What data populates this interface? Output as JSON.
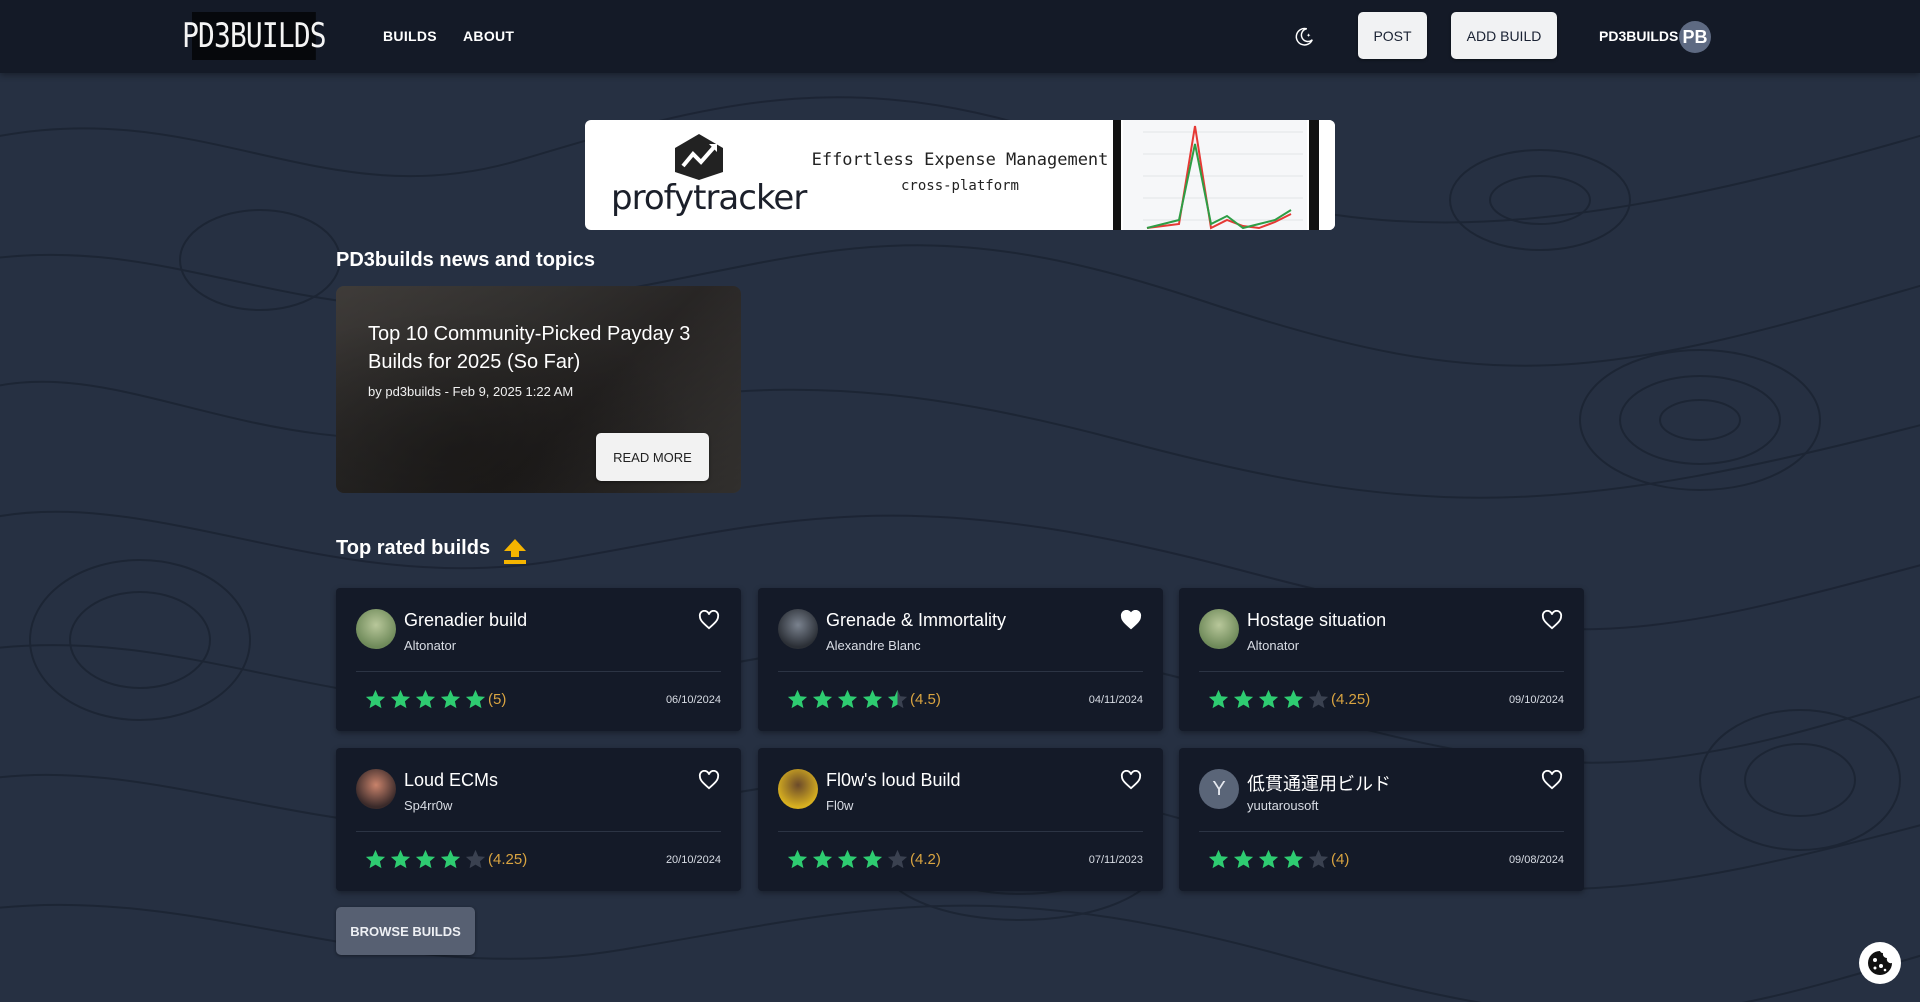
{
  "nav": {
    "logo_text": "PD3BUILDS",
    "links": [
      "BUILDS",
      "ABOUT"
    ],
    "theme_icon": "moon-icon",
    "post_label": "POST",
    "add_build_label": "ADD BUILD",
    "username": "PD3BUILDS",
    "avatar_initials": "PB"
  },
  "ad": {
    "brand": "profytracker",
    "tagline": "Effortless Expense Management",
    "subline": "cross-platform"
  },
  "news": {
    "heading": "PD3builds news and topics",
    "card": {
      "title": "Top 10 Community-Picked Payday 3 Builds for 2025 (So Far)",
      "meta": "by pd3builds - Feb 9, 2025 1:22 AM",
      "button": "READ MORE"
    }
  },
  "top_rated": {
    "heading": "Top rated builds",
    "icon": "trending-up-icon",
    "builds": [
      {
        "title": "Grenadier build",
        "author": "Altonator",
        "stars": 5,
        "rating": "(5)",
        "date": "06/10/2024",
        "favorited": false
      },
      {
        "title": "Grenade & Immortality",
        "author": "Alexandre Blanc",
        "stars": 4.5,
        "rating": "(4.5)",
        "date": "04/11/2024",
        "favorited": true
      },
      {
        "title": "Hostage situation",
        "author": "Altonator",
        "stars": 4,
        "rating": "(4.25)",
        "date": "09/10/2024",
        "favorited": false
      },
      {
        "title": "Loud ECMs",
        "author": "Sp4rr0w",
        "stars": 4,
        "rating": "(4.25)",
        "date": "20/10/2024",
        "favorited": false
      },
      {
        "title": "Fl0w's loud Build",
        "author": "Fl0w",
        "stars": 4,
        "rating": "(4.2)",
        "date": "07/11/2023",
        "favorited": false
      },
      {
        "title": "低貫通運用ビルド",
        "author": "yuutarousoft",
        "avatar_letter": "Y",
        "stars": 4,
        "rating": "(4)",
        "date": "09/08/2024",
        "favorited": false
      }
    ],
    "browse_label": "BROWSE BUILDS"
  },
  "colors": {
    "navbar": "#141a27",
    "background": "#263042",
    "card": "#141a28",
    "star_green": "#2ecc71",
    "rating_gold": "#d9a441"
  },
  "cookie_icon": "cookie-icon"
}
